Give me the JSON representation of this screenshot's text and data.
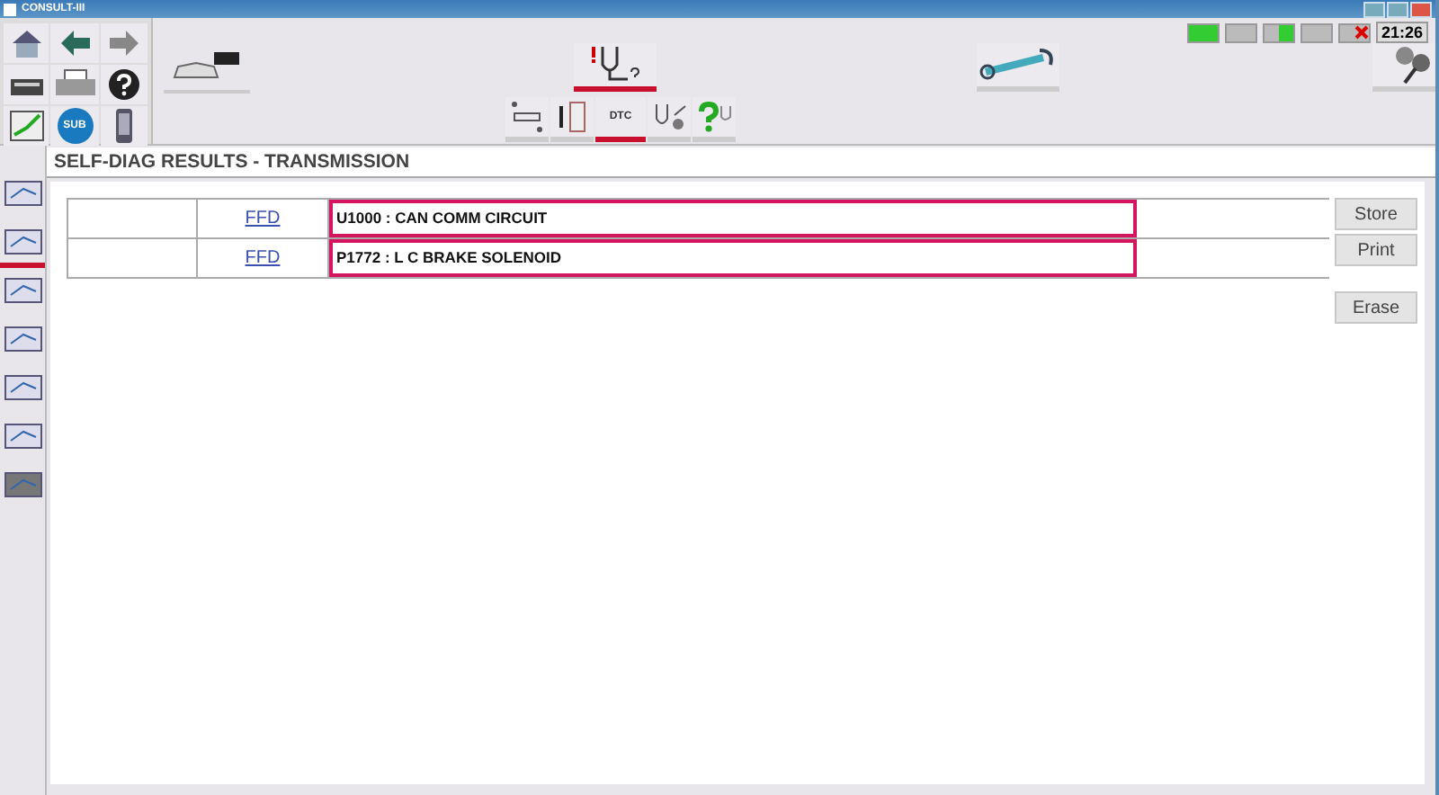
{
  "window": {
    "title": "CONSULT-III"
  },
  "status": {
    "time": "21:26"
  },
  "top_tabs": [
    {
      "kind": "diag",
      "selected": true
    },
    {
      "kind": "wrench",
      "selected": false
    },
    {
      "kind": "gears",
      "selected": false
    }
  ],
  "sub_tabs": [
    {
      "kind": "can",
      "selected": false
    },
    {
      "kind": "data",
      "selected": false
    },
    {
      "kind": "dtc",
      "label": "DTC",
      "selected": true
    },
    {
      "kind": "active",
      "selected": false
    },
    {
      "kind": "help",
      "selected": false
    }
  ],
  "sidebar": {
    "items": [
      {
        "selected": false
      },
      {
        "selected": true
      },
      {
        "selected": false
      },
      {
        "selected": false
      },
      {
        "selected": false
      },
      {
        "selected": false
      },
      {
        "selected": false
      }
    ]
  },
  "nav": {
    "sub_label": "SUB"
  },
  "header": {
    "title": "SELF-DIAG RESULTS - TRANSMISSION"
  },
  "results": [
    {
      "link": "FFD",
      "dtc": "U1000 : CAN COMM CIRCUIT"
    },
    {
      "link": "FFD",
      "dtc": "P1772 : L C BRAKE SOLENOID"
    }
  ],
  "buttons": [
    {
      "label": "Store"
    },
    {
      "label": "Print"
    },
    {
      "label": "Erase"
    }
  ]
}
